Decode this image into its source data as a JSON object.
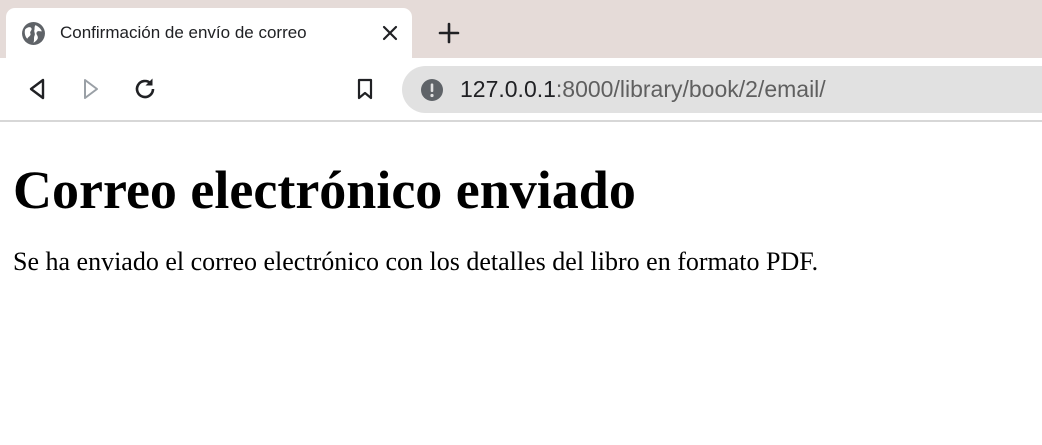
{
  "browser": {
    "tab": {
      "title": "Confirmación de envío de correo",
      "favicon": "globe-icon",
      "close_icon": "close-icon"
    },
    "new_tab_icon": "plus-icon",
    "toolbar": {
      "back_icon": "back-arrow-icon",
      "forward_icon": "forward-arrow-icon",
      "reload_icon": "reload-icon",
      "bookmark_icon": "bookmark-icon",
      "site_info_icon": "info-icon"
    },
    "address": {
      "host": "127.0.0.1",
      "rest": ":8000/library/book/2/email/"
    },
    "colors": {
      "tabstrip_bg": "#e5dbd8",
      "omnibox_bg": "#e1e1e1",
      "icon_dark": "#202124",
      "icon_disabled": "#9aa0a6"
    }
  },
  "page": {
    "heading": "Correo electrónico enviado",
    "message": "Se ha enviado el correo electrónico con los detalles del libro en formato PDF."
  }
}
